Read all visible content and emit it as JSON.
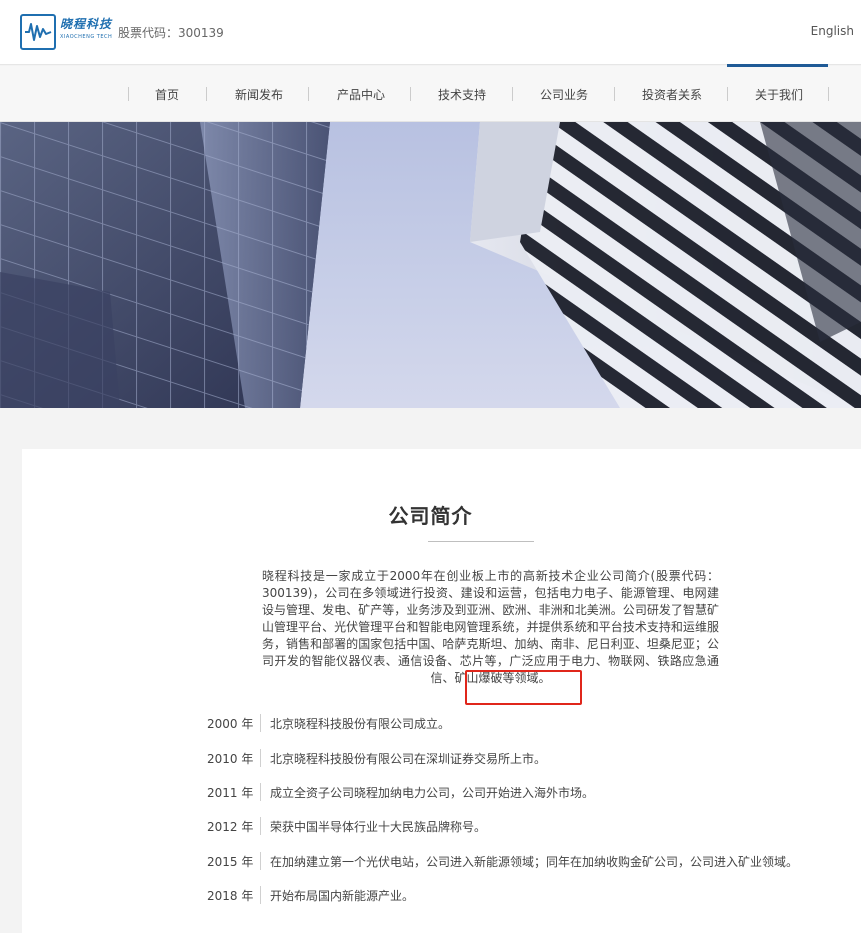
{
  "header": {
    "brand_cn": "晓程科技",
    "brand_en": "XIAOCHENG TECH",
    "stock_code": "股票代码：300139",
    "language": "English"
  },
  "nav": {
    "items": [
      {
        "label": "首页"
      },
      {
        "label": "新闻发布"
      },
      {
        "label": "产品中心"
      },
      {
        "label": "技术支持"
      },
      {
        "label": "公司业务"
      },
      {
        "label": "投资者关系"
      },
      {
        "label": "关于我们"
      }
    ],
    "active": "关于我们"
  },
  "about": {
    "title": "公司简介",
    "intro": "晓程科技是一家成立于2000年在创业板上市的高新技术企业公司简介(股票代码：300139)，公司在多领域进行投资、建设和运营，包括电力电子、能源管理、电网建设与管理、发电、矿产等，业务涉及到亚洲、欧洲、非洲和北美洲。公司研发了智慧矿山管理平台、光伏管理平台和智能电网管理系统，并提供系统和平台技术支持和运维服务，销售和部署的国家包括中国、哈萨克斯坦、加纳、南非、尼日利亚、坦桑尼亚；公司开发的智能仪器仪表、通信设备、芯片等，广泛应用于电力、物联网、铁路应急通信、矿山爆破等领域。"
  },
  "timeline": [
    {
      "year": "2000 年",
      "text": "北京晓程科技股份有限公司成立。"
    },
    {
      "year": "2010 年",
      "text": "北京晓程科技股份有限公司在深圳证券交易所上市。"
    },
    {
      "year": "2011 年",
      "text": "成立全资子公司晓程加纳电力公司，公司开始进入海外市场。"
    },
    {
      "year": "2012 年",
      "text": "荣获中国半导体行业十大民族品牌称号。"
    },
    {
      "year": "2015 年",
      "text": "在加纳建立第一个光伏电站，公司进入新能源领域；同年在加纳收购金矿公司，公司进入矿业领域。"
    },
    {
      "year": "2018 年",
      "text": "开始布局国内新能源产业。"
    }
  ],
  "colors": {
    "brand": "#1f6fb0",
    "nav_accent": "#1f5a96",
    "highlight_box": "#e0261b"
  }
}
